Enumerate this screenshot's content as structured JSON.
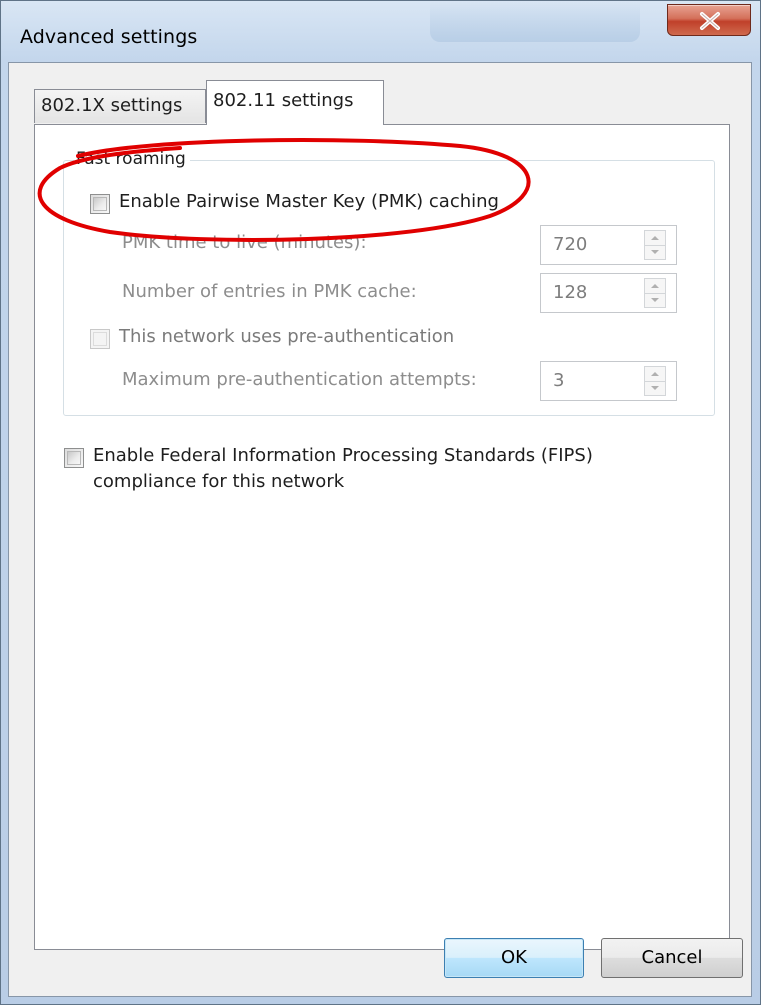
{
  "window": {
    "title": "Advanced settings",
    "close_label": "X"
  },
  "tabs": [
    {
      "label": "802.1X settings",
      "active": false
    },
    {
      "label": "802.11 settings",
      "active": true
    }
  ],
  "fast_roaming": {
    "group_label": "Fast roaming",
    "pmk_caching": {
      "label": "Enable Pairwise Master Key (PMK) caching",
      "checked": false,
      "enabled": true
    },
    "pmk_ttl": {
      "label": "PMK time to live (minutes):",
      "value": "720",
      "enabled": false
    },
    "pmk_entries": {
      "label": "Number of entries in PMK cache:",
      "value": "128",
      "enabled": false
    },
    "preauth": {
      "label": "This network uses pre-authentication",
      "checked": false,
      "enabled": false
    },
    "preauth_attempts": {
      "label": "Maximum pre-authentication attempts:",
      "value": "3",
      "enabled": false
    }
  },
  "fips": {
    "label_line1": "Enable Federal Information Processing Standards (FIPS)",
    "label_line2": "compliance for this network",
    "checked": false
  },
  "annotation": {
    "color": "#e00000",
    "shape": "hand-drawn ellipse"
  },
  "buttons": {
    "ok": "OK",
    "cancel": "Cancel"
  }
}
